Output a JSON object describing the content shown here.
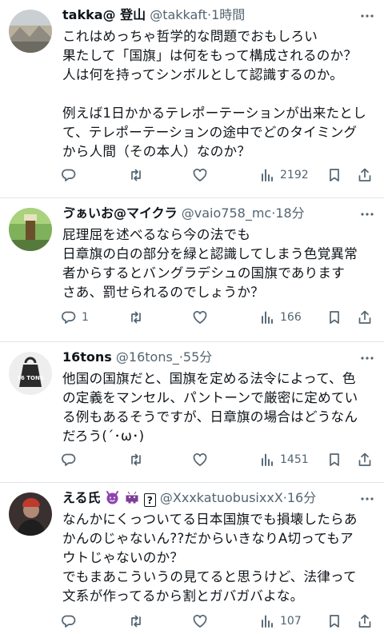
{
  "posts": [
    {
      "name": "takka@ 登山",
      "handle": "@takkaft",
      "dot": "·",
      "time": "1時間",
      "lines": [
        "これはめっちゃ哲学的な問題でおもしろい",
        "果たして「国旗」は何をもって構成されるのか？",
        "人は何を持ってシンボルとして認識するのか。",
        "",
        "例えば1日かかるテレポーテーションが出来たとし",
        "て、テレポーテーションの途中でどのタイミング",
        "から人間（その本人）なのか？"
      ],
      "replies": "",
      "views": "2192"
    },
    {
      "name": "ゔぁいお@マイクラ",
      "handle": "@vaio758_mc",
      "dot": "·",
      "time": "18分",
      "lines": [
        "屁理屈を述べるなら今の法でも",
        "日章旗の白の部分を緑と認識してしまう色覚異常",
        "者からするとバングラデシュの国旗であります",
        "さあ、罰せられるのでしょうか？"
      ],
      "replies": "1",
      "views": "166"
    },
    {
      "name": "16tons",
      "handle": "@16tons_",
      "dot": "·",
      "time": "55分",
      "avatar_text": "16 TONS",
      "lines": [
        "他国の国旗だと、国旗を定める法令によって、色",
        "の定義をマンセル、パントーンで厳密に定めてい",
        "る例もあるそうですが、日章旗の場合はどうなん",
        "だろう(´･ω･)"
      ],
      "replies": "",
      "views": "1451"
    },
    {
      "name": "える氏",
      "name_icons": [
        "smiling-devil-emoji",
        "alien-monster-emoji",
        "question-box-emoji"
      ],
      "name_suffix": "?",
      "handle": "@XxxkatuobusixxX",
      "dot": "·",
      "time": "16分",
      "lines": [
        "なんかにくっついてる日本国旗でも損壊したらあ",
        "かんのじゃないん??だからいきなりA切ってもア",
        "ウトじゃないのか？",
        "でもまあこういうの見てると思うけど、法律って",
        "文系が作ってるから割とガバガバよな。"
      ],
      "replies": "",
      "views": "107"
    }
  ]
}
